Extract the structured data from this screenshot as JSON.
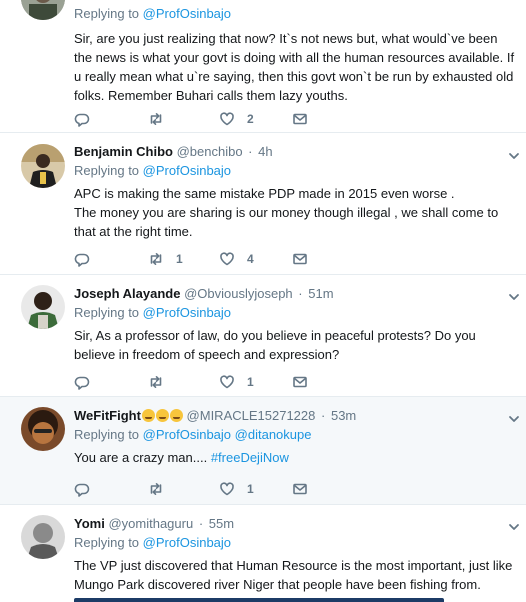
{
  "replying_label": "Replying to",
  "tweets": [
    {
      "fullname": "",
      "handle": "",
      "time": "",
      "reply_to": [
        "@ProfOsinbajo"
      ],
      "text": "Sir, are you just realizing that now? It`s not news but, what would`ve been the news is what your govt is doing with all the human resources available. If u really mean what u`re saying, then this govt won`t be run by exhausted old folks. Remember Buhari calls them lazy youths.",
      "replies": "",
      "retweets": "",
      "likes": "2"
    },
    {
      "fullname": "Benjamin Chibo",
      "handle": "@benchibo",
      "time": "4h",
      "reply_to": [
        "@ProfOsinbajo"
      ],
      "text_lines": [
        "APC is making the same mistake PDP made in 2015 even worse .",
        "The money you are sharing is our money though illegal , we shall come to that at the right time."
      ],
      "replies": "",
      "retweets": "1",
      "likes": "4"
    },
    {
      "fullname": "Joseph Alayande",
      "handle": "@Obviouslyjoseph",
      "time": "51m",
      "reply_to": [
        "@ProfOsinbajo"
      ],
      "text": "Sir, As a professor of law, do you believe in peaceful protests? Do you believe in freedom of speech and expression?",
      "replies": "",
      "retweets": "",
      "likes": "1"
    },
    {
      "fullname": "WeFitFight",
      "handle": "@MIRACLE15271228",
      "time": "53m",
      "reply_to": [
        "@ProfOsinbajo",
        "@ditanokupe"
      ],
      "text": "You are a crazy man.... ",
      "hashtag": "#freeDejiNow",
      "replies": "",
      "retweets": "",
      "likes": "1"
    },
    {
      "fullname": "Yomi",
      "handle": "@yomithaguru",
      "time": "55m",
      "reply_to": [
        "@ProfOsinbajo"
      ],
      "text": "The VP just discovered that Human Resource is the most important, just like Mungo Park discovered river Niger that people have been fishing from."
    }
  ],
  "icons": {
    "reply": "reply-icon",
    "retweet": "retweet-icon",
    "like": "heart-icon",
    "dm": "envelope-icon",
    "more": "chevron-down-icon"
  },
  "colors": {
    "link": "#1b95e0",
    "muted": "#657786",
    "text": "#14171a",
    "highlight_bg": "#f5f8fa"
  }
}
